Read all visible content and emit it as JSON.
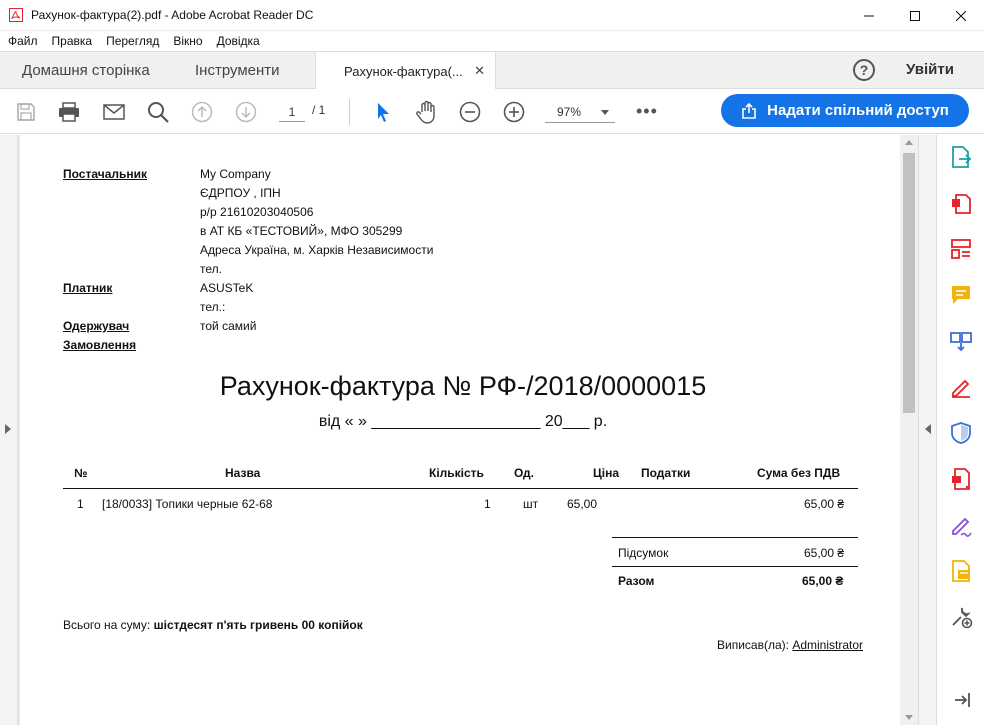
{
  "window": {
    "title": "Рахунок-фактура(2).pdf - Adobe Acrobat Reader DC"
  },
  "menu": [
    "Файл",
    "Правка",
    "Перегляд",
    "Вікно",
    "Довідка"
  ],
  "tabs": {
    "home": "Домашня сторінка",
    "tools": "Інструменти",
    "document": "Рахунок-фактура(..."
  },
  "header": {
    "help": "?",
    "login": "Увійти"
  },
  "toolbar": {
    "page_current": "1",
    "page_total": "/ 1",
    "zoom": "97%",
    "more": "•••",
    "share": "Надати спільний доступ"
  },
  "document": {
    "supplier_label": "Постачальник",
    "supplier_lines": [
      "My Company",
      "ЄДРПОУ , ІПН",
      "р/р 21610203040506",
      "в АТ КБ «ТЕСТОВИЙ», МФО 305299",
      "Адреса Україна, м. Харків Независимости",
      "тел."
    ],
    "payer_label": "Платник",
    "payer_lines": [
      "ASUSTeK",
      "тел.:"
    ],
    "receiver_label": "Одержувач",
    "receiver_value": "той самий",
    "order_label": "Замовлення",
    "title": "Рахунок-фактура № РФ-/2018/0000015",
    "date_line": "від «       » ___________________ 20___ р.",
    "table": {
      "headers": {
        "num": "№",
        "name": "Назва",
        "qty": "Кількість",
        "unit": "Од.",
        "price": "Ціна",
        "taxes": "Податки",
        "sum": "Сума без ПДВ"
      },
      "rows": [
        {
          "num": "1",
          "name": "[18/0033] Топики черные 62-68",
          "qty": "1",
          "unit": "шт",
          "price": "65,00",
          "taxes": "",
          "sum": "65,00 ₴"
        }
      ]
    },
    "subtotal_label": "Підсумок",
    "subtotal_value": "65,00 ₴",
    "total_label": "Разом",
    "total_value": "65,00 ₴",
    "total_words_label": "Всього на суму: ",
    "total_words_value": "шістдесят п'ять гривень 00 копійок",
    "signed_label": "Виписав(ла): ",
    "signed_name": "Administrator"
  },
  "colors": {
    "accent": "#1473e6",
    "adobe_red": "#e5252a"
  }
}
